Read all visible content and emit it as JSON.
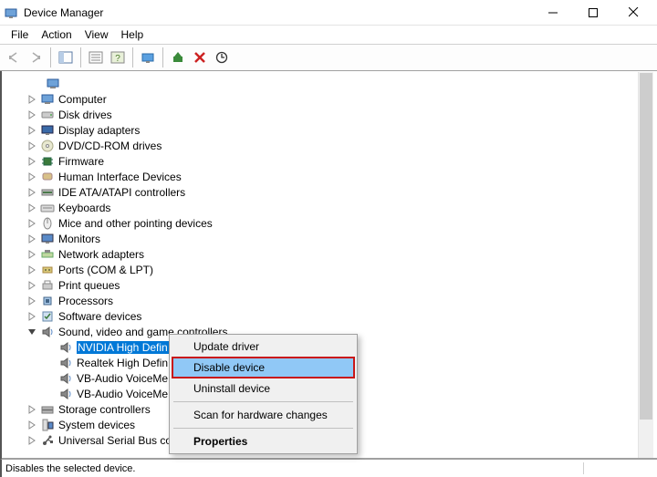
{
  "window": {
    "title": "Device Manager"
  },
  "menus": {
    "file": "File",
    "action": "Action",
    "view": "View",
    "help": "Help"
  },
  "treeTop": {
    "hostIcon": "computer"
  },
  "categories": [
    {
      "label": "Computer",
      "icon": "computer",
      "expandable": true
    },
    {
      "label": "Disk drives",
      "icon": "disk",
      "expandable": true
    },
    {
      "label": "Display adapters",
      "icon": "display",
      "expandable": true
    },
    {
      "label": "DVD/CD-ROM drives",
      "icon": "cd",
      "expandable": true
    },
    {
      "label": "Firmware",
      "icon": "chip",
      "expandable": true
    },
    {
      "label": "Human Interface Devices",
      "icon": "hid",
      "expandable": true
    },
    {
      "label": "IDE ATA/ATAPI controllers",
      "icon": "ide",
      "expandable": true
    },
    {
      "label": "Keyboards",
      "icon": "keyboard",
      "expandable": true
    },
    {
      "label": "Mice and other pointing devices",
      "icon": "mouse",
      "expandable": true
    },
    {
      "label": "Monitors",
      "icon": "monitor",
      "expandable": true
    },
    {
      "label": "Network adapters",
      "icon": "net",
      "expandable": true
    },
    {
      "label": "Ports (COM & LPT)",
      "icon": "port",
      "expandable": true
    },
    {
      "label": "Print queues",
      "icon": "printer",
      "expandable": true
    },
    {
      "label": "Processors",
      "icon": "cpu",
      "expandable": true
    },
    {
      "label": "Software devices",
      "icon": "soft",
      "expandable": true
    },
    {
      "label": "Sound, video and game controllers",
      "icon": "sound",
      "expandable": true,
      "expanded": true,
      "children": [
        {
          "label": "NVIDIA High Defin",
          "icon": "sound",
          "selected": true
        },
        {
          "label": "Realtek High Defin",
          "icon": "sound"
        },
        {
          "label": "VB-Audio VoiceMe",
          "icon": "sound"
        },
        {
          "label": "VB-Audio VoiceMe",
          "icon": "sound"
        }
      ]
    },
    {
      "label": "Storage controllers",
      "icon": "storage",
      "expandable": true
    },
    {
      "label": "System devices",
      "icon": "system",
      "expandable": true
    },
    {
      "label": "Universal Serial Bus co",
      "icon": "usb",
      "expandable": true
    }
  ],
  "contextMenu": {
    "items": [
      {
        "label": "Update driver",
        "type": "item"
      },
      {
        "label": "Disable device",
        "type": "item",
        "highlighted": true
      },
      {
        "label": "Uninstall device",
        "type": "item"
      },
      {
        "type": "sep"
      },
      {
        "label": "Scan for hardware changes",
        "type": "item"
      },
      {
        "type": "sep"
      },
      {
        "label": "Properties",
        "type": "item",
        "bold": true
      }
    ]
  },
  "status": {
    "text": "Disables the selected device."
  }
}
